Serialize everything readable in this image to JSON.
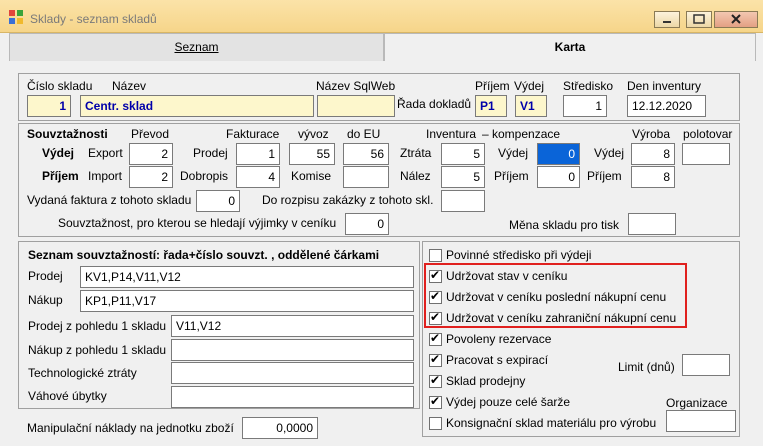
{
  "window": {
    "title": "Sklady - seznam skladů"
  },
  "tabs": [
    {
      "label": "Seznam"
    },
    {
      "label": "Karta"
    }
  ],
  "header": {
    "cislo_label": "Číslo skladu",
    "nazev_label": "Název",
    "sqlweb_label": "Název SqlWeb",
    "rada_label": "Řada dokladů",
    "prijem_label": "Příjem",
    "vydej_label": "Výdej",
    "stredisko_label": "Středisko",
    "den_label": "Den inventury",
    "cislo": "1",
    "nazev": "Centr. sklad",
    "sqlweb": "",
    "prijem": "P1",
    "vydej": "V1",
    "stredisko": "1",
    "den": "12.12.2020"
  },
  "souvz": {
    "title": "Souvztažnosti",
    "prevod": "Převod",
    "fakturace": "Fakturace",
    "vyvoz": "vývoz",
    "do_eu": "do EU",
    "inventura": "Inventura",
    "kompenzace": "– kompenzace",
    "vyroba": "Výroba",
    "polotovar": "polotovar",
    "vydej": "Výdej",
    "prijem": "Příjem",
    "export": "Export",
    "import": "Import",
    "prodej": "Prodej",
    "dobropis": "Dobropis",
    "komise": "Komise",
    "ztrata": "Ztráta",
    "nalez": "Nález",
    "vydej_r": "Výdej",
    "prijem_r": "Příjem",
    "v_export": "2",
    "v_import": "2",
    "v_prodej": "1",
    "v_dobropis": "4",
    "v_vyvoz": "55",
    "v_doeu": "56",
    "v_komise1": "",
    "v_komise2": "",
    "v_ztrata": "5",
    "v_nalez": "5",
    "v_inv_vydej": "0",
    "v_inv_prijem": "0",
    "v_vyroba_vydej": "8",
    "v_vyroba_prijem": "8",
    "v_polotovar": "",
    "faktura_label": "Vydaná faktura z tohoto skladu",
    "faktura": "0",
    "rozpis_label": "Do rozpisu zakázky z tohoto skl.",
    "rozpis": "",
    "vyjimka_label": "Souvztažnost, pro kterou se hledají výjimky v ceníku",
    "vyjimka": "0",
    "mena_label": "Měna skladu pro tisk",
    "mena": ""
  },
  "seznam": {
    "title": "Seznam souvztažností: řada+číslo souvzt. , oddělené čárkami",
    "prodej_label": "Prodej",
    "prodej": "KV1,P14,V11,V12",
    "nakup_label": "Nákup",
    "nakup": "KP1,P11,V17",
    "prodej1_label": "Prodej z pohledu 1 skladu",
    "prodej1": "V11,V12",
    "nakup1_label": "Nákup z pohledu 1 skladu",
    "nakup1": "",
    "tech_label": "Technologické ztráty",
    "tech": "",
    "vah_label": "Váhové úbytky",
    "vah": "",
    "manip_label": "Manipulační náklady na jednotku zboží",
    "manip": "0,0000"
  },
  "options": {
    "povinne": "Povinné středisko při výdeji",
    "stav": "Udržovat stav v ceníku",
    "posledni": "Udržovat v ceníku poslední nákupní cenu",
    "zahranicni": "Udržovat v ceníku zahraniční nákupní cenu",
    "rezervace": "Povoleny rezervace",
    "expirace": "Pracovat s expirací",
    "limit_label": "Limit (dnů)",
    "limit": "",
    "prodejny": "Sklad prodejny",
    "sarze": "Výdej pouze celé šarže",
    "organizace_label": "Organizace",
    "organizace": "",
    "konsignacni": "Konsignační sklad materiálu pro výrobu"
  }
}
